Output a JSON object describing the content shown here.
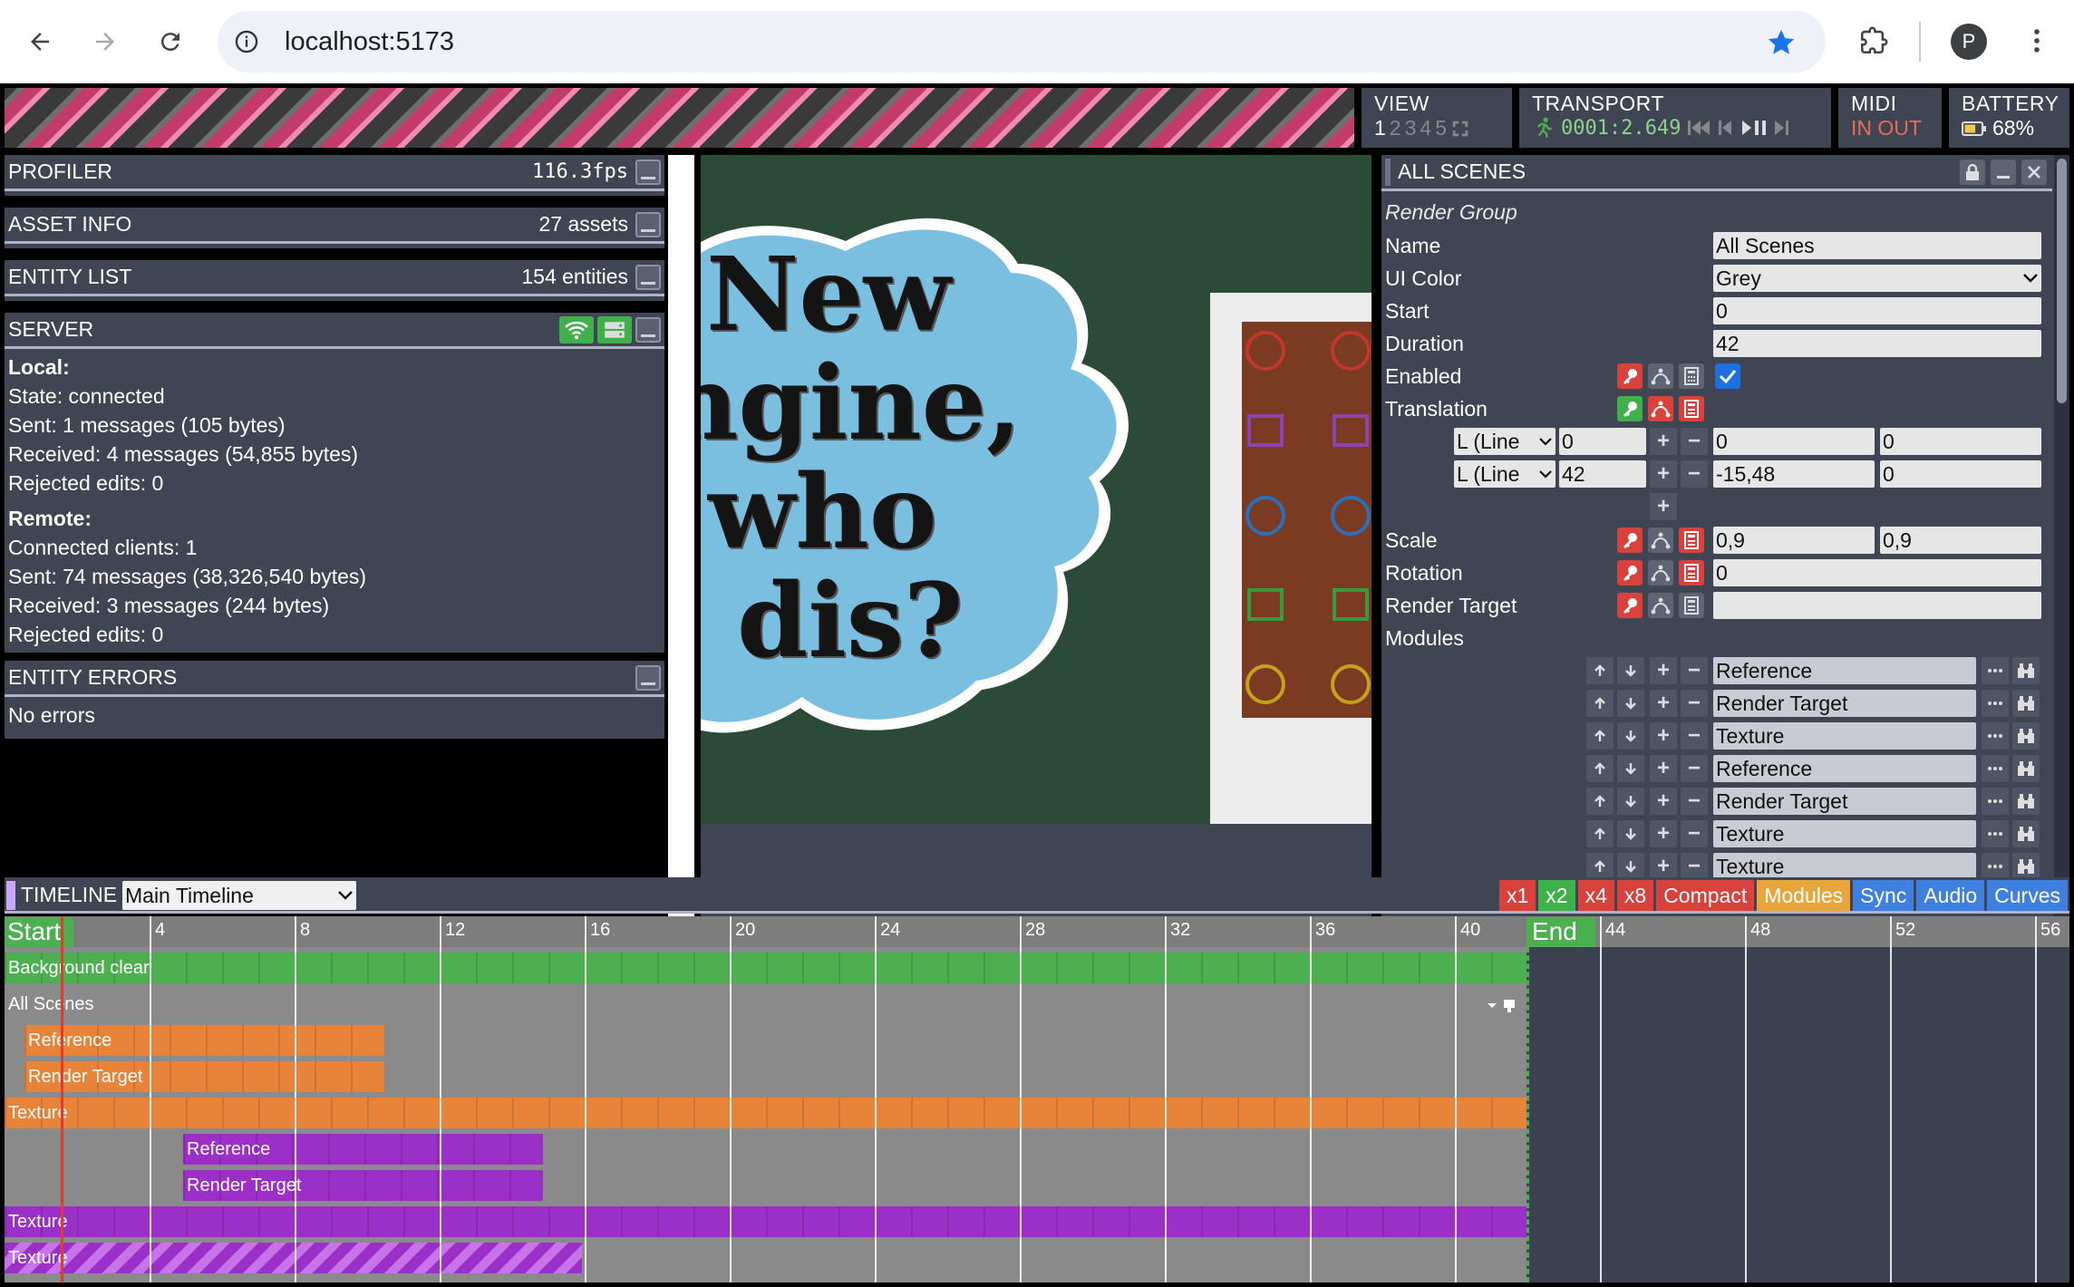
{
  "browser": {
    "url": "localhost:5173",
    "avatar_letter": "P"
  },
  "toolbar": {
    "view": {
      "title": "VIEW",
      "slots": [
        "1",
        "2",
        "3",
        "4",
        "5"
      ]
    },
    "transport": {
      "title": "TRANSPORT",
      "time": "0001:2.649"
    },
    "midi": {
      "title": "MIDI",
      "status": "IN OUT"
    },
    "battery": {
      "title": "BATTERY",
      "level": "68%",
      "level_fraction": 0.68
    }
  },
  "left": {
    "profiler": {
      "title": "PROFILER",
      "value": "116.3fps"
    },
    "asset_info": {
      "title": "ASSET INFO",
      "value": "27 assets"
    },
    "entity_list": {
      "title": "ENTITY LIST",
      "value": "154 entities"
    },
    "server": {
      "title": "SERVER",
      "local_label": "Local:",
      "state": "State: connected",
      "sent": "Sent: 1 messages (105 bytes)",
      "received": "Received: 4 messages (54,855 bytes)",
      "rejected": "Rejected edits: 0",
      "remote_label": "Remote:",
      "clients": "Connected clients: 1",
      "r_sent": "Sent: 74 messages (38,326,540 bytes)",
      "r_received": "Received: 3 messages (244 bytes)",
      "r_rejected": "Rejected edits: 0"
    },
    "entity_errors": {
      "title": "ENTITY ERRORS",
      "text": "No errors"
    }
  },
  "viewport": {
    "headline_lines": [
      "New",
      "ngine,",
      "who",
      "dis?"
    ]
  },
  "inspector": {
    "title": "ALL SCENES",
    "group": "Render Group",
    "name_label": "Name",
    "name_value": "All Scenes",
    "color_label": "UI Color",
    "color_value": "Grey",
    "start_label": "Start",
    "start_value": "0",
    "duration_label": "Duration",
    "duration_value": "42",
    "enabled_label": "Enabled",
    "translation_label": "Translation",
    "key1": {
      "interp": "L (Line",
      "time": "0",
      "x": "0",
      "y": "0"
    },
    "key2": {
      "interp": "L (Line",
      "time": "42",
      "x": "-15,48",
      "y": "0"
    },
    "scale_label": "Scale",
    "scale_x": "0,9",
    "scale_y": "0,9",
    "rotation_label": "Rotation",
    "rotation_value": "0",
    "rt_label": "Render Target",
    "rt_value": "",
    "modules_label": "Modules",
    "modules": [
      "Reference",
      "Render Target",
      "Texture",
      "Reference",
      "Render Target",
      "Texture",
      "Texture"
    ]
  },
  "timeline": {
    "title": "TIMELINE",
    "selected": "Main Timeline",
    "zoom": [
      "x1",
      "x2",
      "x4",
      "x8"
    ],
    "buttons": [
      "Compact",
      "Modules",
      "Sync",
      "Audio",
      "Curves"
    ],
    "start_label": "Start",
    "end_label": "End",
    "ticks": [
      "4",
      "8",
      "12",
      "16",
      "20",
      "24",
      "28",
      "32",
      "36",
      "40",
      "44",
      "48",
      "52",
      "56"
    ],
    "rows": {
      "bg": "Background clear",
      "scenes": "All Scenes",
      "ref1": "Reference",
      "rt1": "Render Target",
      "tex1": "Texture",
      "ref2": "Reference",
      "rt2": "Render Target",
      "tex2": "Texture",
      "tex3": "Texture"
    }
  },
  "colors": {
    "panel": "#404554",
    "green": "#4caf50",
    "orange": "#e8833a",
    "purple": "#9b30c8",
    "grid": "#8a8a8a"
  }
}
